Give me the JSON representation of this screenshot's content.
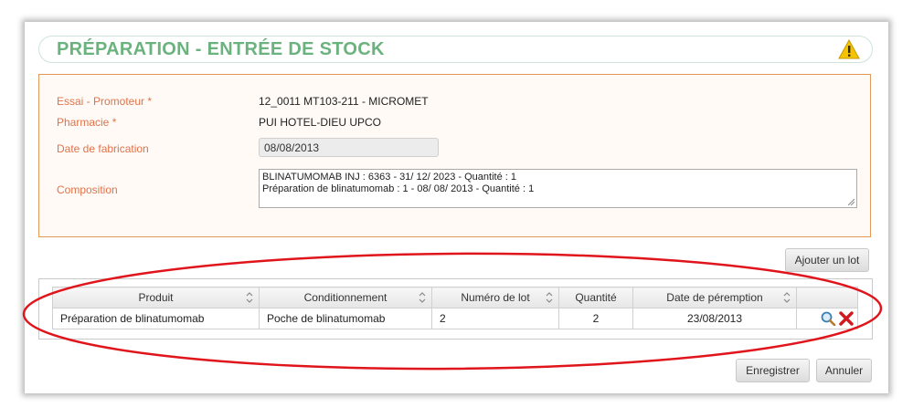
{
  "page": {
    "title": "PRÉPARATION - ENTRÉE DE STOCK",
    "warning_icon": "warning-icon"
  },
  "form": {
    "essai_label": "Essai - Promoteur *",
    "essai_value": "12_0011 MT103-211 - MICROMET",
    "pharmacie_label": "Pharmacie *",
    "pharmacie_value": "PUI HOTEL-DIEU UPCO",
    "date_label": "Date de fabrication",
    "date_value": "08/08/2013",
    "composition_label": "Composition",
    "composition_line1": "BLINATUMOMAB INJ : 6363 - 31/ 12/ 2023 - Quantité : 1",
    "composition_line2": "Préparation de blinatumomab : 1 - 08/ 08/ 2013 - Quantité : 1"
  },
  "buttons": {
    "add_lot": "Ajouter un lot",
    "save": "Enregistrer",
    "cancel": "Annuler"
  },
  "table": {
    "headers": [
      "Produit",
      "Conditionnement",
      "Numéro de lot",
      "Quantité",
      "Date de péremption"
    ],
    "rows": [
      {
        "produit": "Préparation de blinatumomab",
        "conditionnement": "Poche de blinatumomab",
        "numero_lot": "2",
        "quantite": "2",
        "date_peremption": "23/08/2013",
        "actions": [
          "magnifier-icon",
          "delete-icon"
        ]
      }
    ]
  },
  "colors": {
    "title_green": "#6bb37e",
    "label_orange": "#e0734a",
    "form_border": "#e29a5a",
    "annotation_red": "#e0151c",
    "delete_red": "#d0181e"
  }
}
